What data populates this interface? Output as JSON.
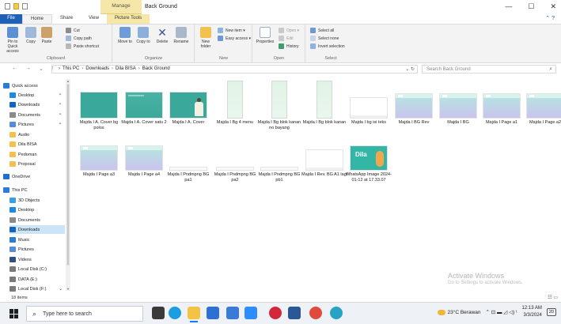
{
  "window": {
    "title": "Back Ground",
    "manage_tab": "Manage",
    "controls": {
      "minimize": "—",
      "maximize": "☐",
      "close": "✕"
    }
  },
  "ribbon_tabs": {
    "file": "File",
    "home": "Home",
    "share": "Share",
    "view": "View",
    "picture_tools": "Picture Tools",
    "right_icons": "⌃ ?"
  },
  "ribbon": {
    "clipboard": {
      "title": "Clipboard",
      "pin": "Pin to Quick access",
      "copy": "Copy",
      "paste": "Paste",
      "cut": "Cut",
      "copy_path": "Copy path",
      "paste_shortcut": "Paste shortcut"
    },
    "organize": {
      "title": "Organize",
      "move_to": "Move to",
      "copy_to": "Copy to",
      "delete": "Delete",
      "rename": "Rename"
    },
    "new": {
      "title": "New",
      "new_folder": "New folder",
      "new_item": "New item ▾",
      "easy_access": "Easy access ▾"
    },
    "open": {
      "title": "Open",
      "properties": "Properties",
      "open": "Open ▾",
      "edit": "Edit",
      "history": "History"
    },
    "select": {
      "title": "Select",
      "select_all": "Select all",
      "select_none": "Select none",
      "invert_selection": "Invert selection"
    }
  },
  "address": {
    "nav": {
      "back": "←",
      "forward": "→",
      "recent": "⌄",
      "up": "↑"
    },
    "crumbs": [
      "This PC",
      "Downloads",
      "Dila BISA",
      "Back Ground"
    ],
    "sep": "›",
    "controls": "⌄  ↻",
    "search_placeholder": "Search Back Ground",
    "search_icon": "⌕"
  },
  "nav_pane": {
    "items": [
      {
        "label": "Quick access",
        "icon": "star-icon",
        "color": "#2b7cd3"
      },
      {
        "label": "Desktop",
        "icon": "desktop-icon",
        "color": "#1e88e5"
      },
      {
        "label": "Downloads",
        "icon": "download-icon",
        "color": "#1565c0"
      },
      {
        "label": "Documents",
        "icon": "documents-icon",
        "color": "#8a8a8a"
      },
      {
        "label": "Pictures",
        "icon": "pictures-icon",
        "color": "#5a8bd6"
      },
      {
        "label": "Audio",
        "icon": "folder-icon",
        "color": "#f2c14e"
      },
      {
        "label": "Dila BISA",
        "icon": "folder-icon",
        "color": "#f2c14e"
      },
      {
        "label": "Pedoman",
        "icon": "folder-icon",
        "color": "#f2c14e"
      },
      {
        "label": "Proposal",
        "icon": "folder-icon",
        "color": "#f2c14e"
      },
      {
        "label": "OneDrive",
        "icon": "cloud-icon",
        "color": "#1f6fd1"
      },
      {
        "label": "This PC",
        "icon": "pc-icon",
        "color": "#2b7cd3"
      },
      {
        "label": "3D Objects",
        "icon": "cube-icon",
        "color": "#39a0e0"
      },
      {
        "label": "Desktop",
        "icon": "desktop-icon",
        "color": "#1e88e5"
      },
      {
        "label": "Documents",
        "icon": "documents-icon",
        "color": "#8a8a8a"
      },
      {
        "label": "Downloads",
        "icon": "download-icon",
        "color": "#1565c0"
      },
      {
        "label": "Music",
        "icon": "music-icon",
        "color": "#2b7cd3"
      },
      {
        "label": "Pictures",
        "icon": "pictures-icon",
        "color": "#5a8bd6"
      },
      {
        "label": "Videos",
        "icon": "video-icon",
        "color": "#2f4f80"
      },
      {
        "label": "Local Disk (C:)",
        "icon": "drive-icon",
        "color": "#7a7a7a"
      },
      {
        "label": "DATA (E:)",
        "icon": "drive-icon",
        "color": "#7a7a7a"
      },
      {
        "label": "Local Disk (F:)",
        "icon": "drive-icon",
        "color": "#7a7a7a"
      }
    ],
    "selected": "Downloads",
    "pin_glyph": "✦",
    "expand_glyph": "⌄"
  },
  "files": [
    {
      "name": "Majda I A. Cover bg polos",
      "kind": "teal"
    },
    {
      "name": "Majda I A. Cover satu 2",
      "kind": "teal-dots"
    },
    {
      "name": "Majda I A. Cover",
      "kind": "teal-figure"
    },
    {
      "name": "Majda I Bg 4 menu",
      "kind": "mint-tall"
    },
    {
      "name": "Majda I Bg blok kanan no bayang",
      "kind": "mint-tall"
    },
    {
      "name": "Majda I Bg blok kanan",
      "kind": "mint-tall"
    },
    {
      "name": "Majda I bg isi teks",
      "kind": "white-wide"
    },
    {
      "name": "Majda I BG Rev",
      "kind": "gradient"
    },
    {
      "name": "Majda I BG",
      "kind": "gradient"
    },
    {
      "name": "Majda I Page a1",
      "kind": "gradient"
    },
    {
      "name": "Majda I Page a2",
      "kind": "gradient"
    },
    {
      "name": "Majda I Page a3",
      "kind": "gradient"
    },
    {
      "name": "Majda I Page a4",
      "kind": "gradient"
    },
    {
      "name": "Majda I Pndmpng BG pa1",
      "kind": "white-strip"
    },
    {
      "name": "Majda I Pndmpng BG pa2",
      "kind": "white-strip"
    },
    {
      "name": "Majda I Pndmpng BG pb1",
      "kind": "white-strip"
    },
    {
      "name": "Majda I Rev. BG A1 lagi",
      "kind": "white-wide"
    },
    {
      "name": "WhatsApp Image 2024-01-12 at 17.33.07",
      "kind": "whatsapp"
    }
  ],
  "whatsapp_thumb_text": "Dila",
  "watermark": {
    "line1": "Activate Windows",
    "line2": "Go to Settings to activate Windows."
  },
  "status": {
    "count": "18 items",
    "view_icons": "☷ ▭"
  },
  "taskbar": {
    "search_placeholder": "Type here to search",
    "search_icon": "⌕",
    "weather": "23°C  Berawan",
    "tray_icons": "⌃  ⊡  ▬  ◿  ◁)  ᵗ",
    "time": "12:13 AM",
    "date": "3/3/2024",
    "notification_count": "20",
    "apps": [
      {
        "name": "task-view",
        "color": "#3a3a3a"
      },
      {
        "name": "edge",
        "color": "#1b9de2"
      },
      {
        "name": "file-explorer",
        "color": "#f3c343"
      },
      {
        "name": "mail",
        "color": "#2d6fd3"
      },
      {
        "name": "store",
        "color": "#3a7bd5"
      },
      {
        "name": "zoom",
        "color": "#2d8cff"
      },
      {
        "name": "opera",
        "color": "#d3283b"
      },
      {
        "name": "word",
        "color": "#2b5797"
      },
      {
        "name": "chrome",
        "color": "#e14b3b"
      },
      {
        "name": "globe",
        "color": "#27a3c4"
      }
    ],
    "active_app": "file-explorer"
  },
  "colors": {
    "accent": "#1f5fb6",
    "teal": "#3aa89a",
    "selected": "#cce4f7"
  }
}
